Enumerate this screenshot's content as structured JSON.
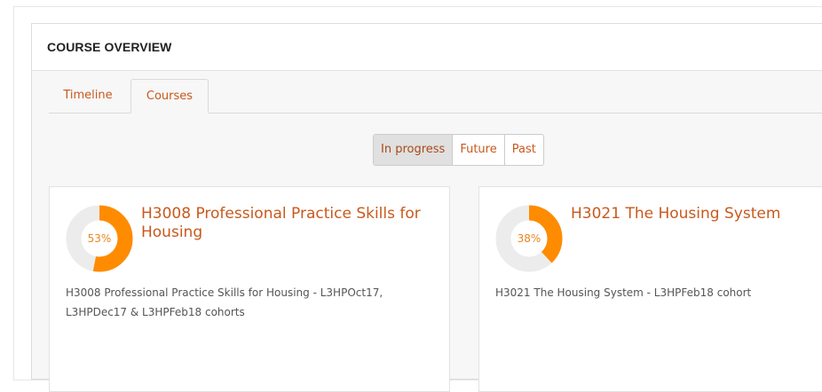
{
  "block": {
    "title": "COURSE OVERVIEW"
  },
  "tabs": [
    {
      "label": "Timeline"
    },
    {
      "label": "Courses"
    }
  ],
  "filters": [
    {
      "label": "In progress",
      "active": true
    },
    {
      "label": "Future",
      "active": false
    },
    {
      "label": "Past",
      "active": false
    }
  ],
  "courses": [
    {
      "title": "H3008 Professional Practice Skills for Housing",
      "progress_label": "53%",
      "progress": 0.53,
      "summary": "H3008 Professional Practice Skills for Housing - L3HPOct17, L3HPDec17 & L3HPFeb18 cohorts"
    },
    {
      "title": "H3021 The Housing System",
      "progress_label": "38%",
      "progress": 0.38,
      "summary": "H3021 The Housing System - L3HPFeb18 cohort"
    }
  ],
  "colors": {
    "accent": "#c8591c",
    "progress_fill": "#ff8b00",
    "progress_track": "#ececec"
  }
}
